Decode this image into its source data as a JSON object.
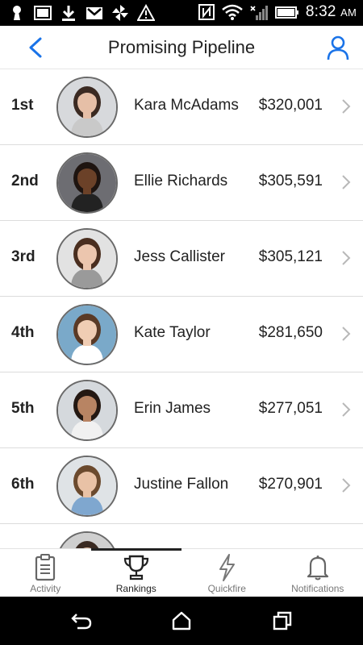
{
  "status_bar": {
    "time": "8:32",
    "ampm": "AM",
    "left_icons": [
      "keyhole-icon",
      "image-icon",
      "download-icon",
      "gmail-icon",
      "pinwheel-icon",
      "alert-icon"
    ],
    "right_icons": [
      "nfc-icon",
      "wifi-icon",
      "signal-icon",
      "battery-icon"
    ]
  },
  "header": {
    "title": "Promising Pipeline",
    "back_icon": "chevron-left-icon",
    "profile_icon": "user-icon",
    "accent_color": "#1a73e8"
  },
  "leaderboard": [
    {
      "rank": "1st",
      "name": "Kara McAdams",
      "amount": "$320,001",
      "avatar": {
        "bg": "#d7d9dc",
        "skin": "#e6bfa7",
        "hair": "#3b2a22",
        "shirt": "#c9c9c9"
      }
    },
    {
      "rank": "2nd",
      "name": "Ellie Richards",
      "amount": "$305,591",
      "avatar": {
        "bg": "#6d6d72",
        "skin": "#6b4128",
        "hair": "#1e1410",
        "shirt": "#222222"
      }
    },
    {
      "rank": "3rd",
      "name": "Jess Callister",
      "amount": "$305,121",
      "avatar": {
        "bg": "#e2e2e2",
        "skin": "#ecc6ae",
        "hair": "#4a2e1f",
        "shirt": "#9a9a9a"
      }
    },
    {
      "rank": "4th",
      "name": "Kate Taylor",
      "amount": "$281,650",
      "avatar": {
        "bg": "#7aa9c9",
        "skin": "#f0cdb4",
        "hair": "#5a3a26",
        "shirt": "#ffffff"
      }
    },
    {
      "rank": "5th",
      "name": "Erin James",
      "amount": "$277,051",
      "avatar": {
        "bg": "#d5d9dd",
        "skin": "#b88463",
        "hair": "#241812",
        "shirt": "#f1f1f1"
      }
    },
    {
      "rank": "6th",
      "name": "Justine Fallon",
      "amount": "$270,901",
      "avatar": {
        "bg": "#dfe3e6",
        "skin": "#e9c2a6",
        "hair": "#6b4a2e",
        "shirt": "#7fa7cf"
      }
    },
    {
      "rank": "",
      "name": "",
      "amount": "",
      "avatar": {
        "bg": "#cfcfcf",
        "skin": "#d9b195",
        "hair": "#3a2a22",
        "shirt": "#444444"
      }
    }
  ],
  "tabs": [
    {
      "label": "Activity",
      "icon": "clipboard-icon",
      "active": false
    },
    {
      "label": "Rankings",
      "icon": "trophy-icon",
      "active": true
    },
    {
      "label": "Quickfire",
      "icon": "lightning-icon",
      "active": false
    },
    {
      "label": "Notifications",
      "icon": "bell-icon",
      "active": false
    }
  ],
  "nav_bar": {
    "buttons": [
      "back-nav-icon",
      "home-nav-icon",
      "recents-nav-icon"
    ]
  }
}
